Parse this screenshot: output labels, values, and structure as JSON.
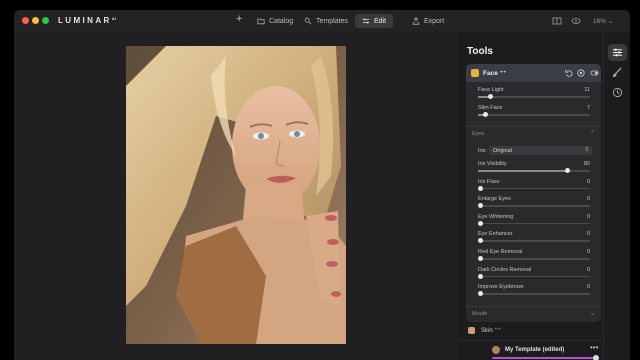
{
  "window": {
    "brand": "LUMINAR",
    "brand_sup": "AI"
  },
  "nav": {
    "catalog": "Catalog",
    "templates": "Templates",
    "edit": "Edit",
    "export": "Export",
    "zoom": "16%"
  },
  "tools": {
    "title": "Tools",
    "face": {
      "title": "Face ⁺⁺",
      "sliders": [
        {
          "label": "Face Light",
          "value": "11",
          "level": 0.11
        },
        {
          "label": "Slim Face",
          "value": "7",
          "level": 0.07
        }
      ],
      "eyes": {
        "title": "Eyes",
        "iris_label": "Iris:",
        "iris_value": "Original",
        "sliders": [
          {
            "label": "Iris Visibility",
            "value": "80",
            "level": 0.8
          },
          {
            "label": "Iris Flare",
            "value": "0",
            "level": 0
          },
          {
            "label": "Enlarge Eyes",
            "value": "0",
            "level": 0
          },
          {
            "label": "Eye Whitening",
            "value": "0",
            "level": 0
          },
          {
            "label": "Eye Enhancer",
            "value": "0",
            "level": 0
          },
          {
            "label": "Red Eye Removal",
            "value": "0",
            "level": 0
          },
          {
            "label": "Dark Circles Removal",
            "value": "0",
            "level": 0
          },
          {
            "label": "Improve Eyebrows",
            "value": "0",
            "level": 0
          }
        ]
      },
      "mouth": "Mouth"
    },
    "skin": "Skin ⁺⁺"
  },
  "template": {
    "name": "My Template (edited)",
    "more": "•••",
    "amount": 1.0
  },
  "colors": {
    "accent": "#b64ecf",
    "face_icon": "#e7b13e",
    "header_bg": "#3a3c48"
  },
  "icons": {
    "traffic_lights": [
      "close-dot",
      "minimize-dot",
      "zoom-dot"
    ],
    "rail": [
      "sliders-icon",
      "brush-icon",
      "history-icon"
    ]
  }
}
